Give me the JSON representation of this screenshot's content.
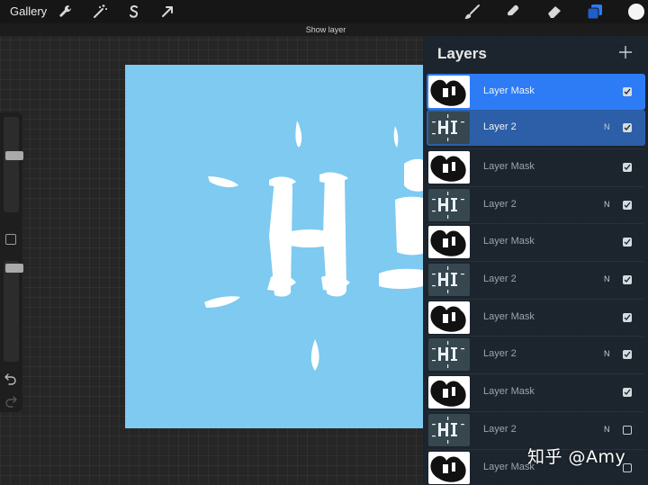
{
  "topbar": {
    "gallery_label": "Gallery",
    "left_tools": [
      {
        "name": "actions-icon",
        "glyph": "wrench"
      },
      {
        "name": "adjustments-icon",
        "glyph": "magic-wand"
      },
      {
        "name": "selection-icon",
        "glyph": "s-curve"
      },
      {
        "name": "transform-icon",
        "glyph": "arrow"
      }
    ],
    "right_tools": [
      {
        "name": "brush-icon"
      },
      {
        "name": "smudge-icon"
      },
      {
        "name": "eraser-icon"
      },
      {
        "name": "layers-icon"
      },
      {
        "name": "color-picker-icon"
      }
    ],
    "status_message": "Show layer"
  },
  "colors": {
    "accent_selected": "#2d7cf5",
    "secondary_selected": "#2c5fa8",
    "canvas": "#7ecaf1",
    "current_color": "#ffffff"
  },
  "layers": {
    "title": "Layers",
    "rows": [
      {
        "name": "Layer Mask",
        "kind": "mask",
        "state": "sel-mask",
        "blend": "",
        "visible": true
      },
      {
        "name": "Layer 2",
        "kind": "layer",
        "state": "sel-layer",
        "blend": "N",
        "visible": true
      },
      {
        "name": "Layer Mask",
        "kind": "mask",
        "state": "unsel",
        "blend": "",
        "visible": true
      },
      {
        "name": "Layer 2",
        "kind": "layer",
        "state": "unsel",
        "blend": "N",
        "visible": true
      },
      {
        "name": "Layer Mask",
        "kind": "mask",
        "state": "unsel",
        "blend": "",
        "visible": true
      },
      {
        "name": "Layer 2",
        "kind": "layer",
        "state": "unsel",
        "blend": "N",
        "visible": true
      },
      {
        "name": "Layer Mask",
        "kind": "mask",
        "state": "unsel",
        "blend": "",
        "visible": true
      },
      {
        "name": "Layer 2",
        "kind": "layer",
        "state": "unsel",
        "blend": "N",
        "visible": true
      },
      {
        "name": "Layer Mask",
        "kind": "mask",
        "state": "unsel",
        "blend": "",
        "visible": true
      },
      {
        "name": "Layer 2",
        "kind": "layer",
        "state": "unsel",
        "blend": "N",
        "visible": false
      },
      {
        "name": "Layer Mask",
        "kind": "mask",
        "state": "unsel",
        "blend": "",
        "visible": false
      }
    ]
  },
  "sidebar": {
    "brush_size": 0.6,
    "brush_opacity": 0.03
  },
  "watermark": "知乎 @Amy"
}
